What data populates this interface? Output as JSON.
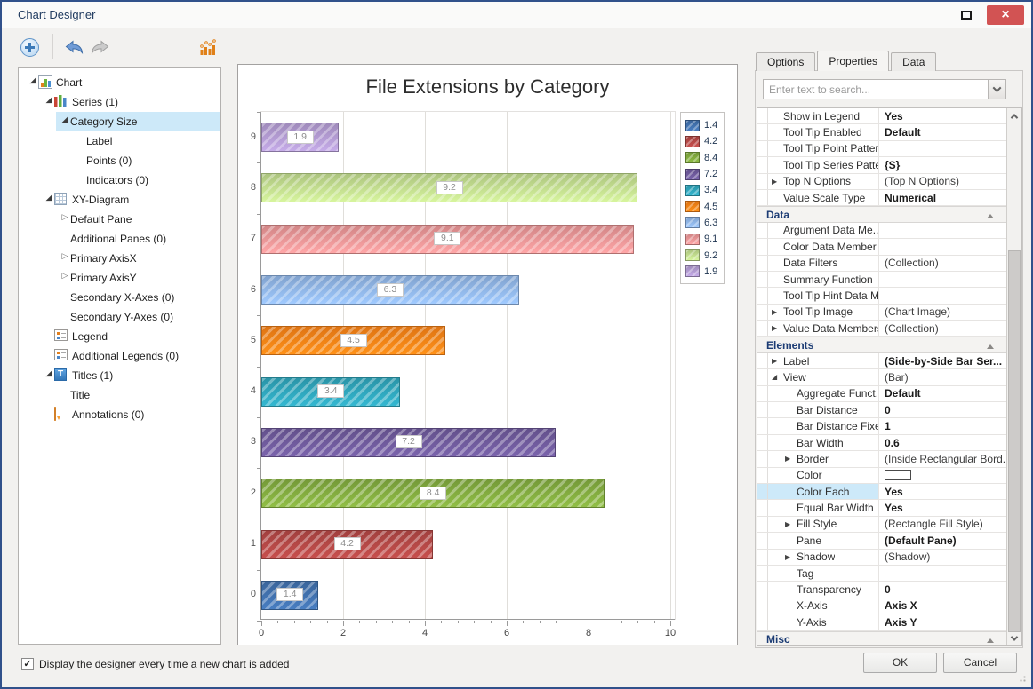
{
  "window": {
    "title": "Chart Designer"
  },
  "toolbar": {
    "buttons": [
      {
        "name": "add-chart-element-button",
        "icon": "plus-icon"
      },
      {
        "name": "undo-button",
        "icon": "undo-arrow-icon"
      },
      {
        "name": "redo-button",
        "icon": "redo-arrow-icon"
      },
      {
        "name": "chart-type-button",
        "icon": "bar-chart-icon"
      }
    ]
  },
  "icons": {
    "maximize": "square-outline",
    "close": "×",
    "checkbox_check": "✓"
  },
  "tree": {
    "items": [
      {
        "label": "Chart",
        "level": 0,
        "state": "expanded",
        "icon": "bar-chart"
      },
      {
        "label": "Series (1)",
        "level": 1,
        "state": "expanded",
        "icon": "series"
      },
      {
        "label": "Category Size",
        "level": 2,
        "state": "expanded",
        "selected": true
      },
      {
        "label": "Label",
        "level": 3
      },
      {
        "label": "Points (0)",
        "level": 3
      },
      {
        "label": "Indicators (0)",
        "level": 3
      },
      {
        "label": "XY-Diagram",
        "level": 1,
        "state": "expanded",
        "icon": "grid"
      },
      {
        "label": "Default Pane",
        "level": 2,
        "state": "collapsed"
      },
      {
        "label": "Additional Panes (0)",
        "level": 2
      },
      {
        "label": "Primary AxisX",
        "level": 2,
        "state": "collapsed"
      },
      {
        "label": "Primary AxisY",
        "level": 2,
        "state": "collapsed"
      },
      {
        "label": "Secondary X-Axes (0)",
        "level": 2
      },
      {
        "label": "Secondary Y-Axes (0)",
        "level": 2
      },
      {
        "label": "Legend",
        "level": 1,
        "icon": "legend"
      },
      {
        "label": "Additional Legends (0)",
        "level": 1,
        "icon": "legend"
      },
      {
        "label": "Titles (1)",
        "level": 1,
        "state": "expanded",
        "icon": "title"
      },
      {
        "label": "Title",
        "level": 2
      },
      {
        "label": "Annotations (0)",
        "level": 1,
        "icon": "annotation"
      }
    ]
  },
  "chart_data": {
    "type": "bar",
    "orientation": "horizontal",
    "title": "File Extensions by Category",
    "categories": [
      "0",
      "1",
      "2",
      "3",
      "4",
      "5",
      "6",
      "7",
      "8",
      "9"
    ],
    "values": [
      1.4,
      4.2,
      8.4,
      7.2,
      3.4,
      4.5,
      6.3,
      9.1,
      9.2,
      1.9
    ],
    "data_labels": [
      "1.4",
      "4.2",
      "8.4",
      "7.2",
      "3.4",
      "4.5",
      "6.3",
      "9.1",
      "9.2",
      "1.9"
    ],
    "bar_colors": [
      "#3e6da7",
      "#ad4543",
      "#7da53c",
      "#6a5695",
      "#2d9fb4",
      "#ef7d15",
      "#8aaede",
      "#e18f90",
      "#b9d387",
      "#ab94c9"
    ],
    "hatch": "diagonal-stripes",
    "xlabel": "",
    "ylabel": "",
    "xlim": [
      0,
      10.15
    ],
    "x_ticks": [
      0,
      2,
      4,
      6,
      8,
      10
    ],
    "grid": "vertical-major",
    "legend": {
      "position": "top-right",
      "labels": [
        "1.4",
        "4.2",
        "8.4",
        "7.2",
        "3.4",
        "4.5",
        "6.3",
        "9.1",
        "9.2",
        "1.9"
      ]
    }
  },
  "right_panel": {
    "tabs": [
      {
        "label": "Options",
        "active": false
      },
      {
        "label": "Properties",
        "active": true
      },
      {
        "label": "Data",
        "active": false
      }
    ],
    "search": {
      "placeholder": "Enter text to search..."
    },
    "property_grid": {
      "rows": [
        {
          "name": "Show in Legend",
          "value": "Yes",
          "bold": true
        },
        {
          "name": "Tool Tip Enabled",
          "value": "Default",
          "bold": true
        },
        {
          "name": "Tool Tip Point Pattern",
          "value": ""
        },
        {
          "name": "Tool Tip Series Pattern",
          "value": "{S}",
          "bold": true
        },
        {
          "name": "Top N Options",
          "value": "(Top N Options)",
          "arrow": "collapsed"
        },
        {
          "name": "Value Scale Type",
          "value": "Numerical",
          "bold": true
        },
        {
          "cat": "Data"
        },
        {
          "name": "Argument Data Me...",
          "value": ""
        },
        {
          "name": "Color Data Member",
          "value": ""
        },
        {
          "name": "Data Filters",
          "value": "(Collection)"
        },
        {
          "name": "Summary Function",
          "value": ""
        },
        {
          "name": "Tool Tip Hint Data M...",
          "value": ""
        },
        {
          "name": "Tool Tip Image",
          "value": "(Chart Image)",
          "arrow": "collapsed"
        },
        {
          "name": "Value Data Members",
          "value": "(Collection)",
          "arrow": "collapsed"
        },
        {
          "cat": "Elements"
        },
        {
          "name": "Label",
          "value": "(Side-by-Side Bar Ser...",
          "bold": true,
          "arrow": "collapsed"
        },
        {
          "name": "View",
          "value": "(Bar)",
          "arrow": "expanded"
        },
        {
          "name": "Aggregate Funct...",
          "value": "Default",
          "bold": true,
          "indent": 1
        },
        {
          "name": "Bar Distance",
          "value": "0",
          "bold": true,
          "indent": 1
        },
        {
          "name": "Bar Distance Fixed",
          "value": "1",
          "bold": true,
          "indent": 1
        },
        {
          "name": "Bar Width",
          "value": "0.6",
          "bold": true,
          "indent": 1
        },
        {
          "name": "Border",
          "value": "(Inside Rectangular Bord...",
          "arrow": "collapsed",
          "indent": 1
        },
        {
          "name": "Color",
          "value": "",
          "swatch": true,
          "indent": 1
        },
        {
          "name": "Color Each",
          "value": "Yes",
          "bold": true,
          "indent": 1,
          "selected": true
        },
        {
          "name": "Equal Bar Width",
          "value": "Yes",
          "bold": true,
          "indent": 1
        },
        {
          "name": "Fill Style",
          "value": "(Rectangle Fill Style)",
          "arrow": "collapsed",
          "indent": 1
        },
        {
          "name": "Pane",
          "value": "(Default Pane)",
          "bold": true,
          "indent": 1
        },
        {
          "name": "Shadow",
          "value": "(Shadow)",
          "arrow": "collapsed",
          "indent": 1
        },
        {
          "name": "Tag",
          "value": "",
          "indent": 1
        },
        {
          "name": "Transparency",
          "value": "0",
          "bold": true,
          "indent": 1
        },
        {
          "name": "X-Axis",
          "value": "Axis X",
          "bold": true,
          "indent": 1
        },
        {
          "name": "Y-Axis",
          "value": "Axis Y",
          "bold": true,
          "indent": 1
        },
        {
          "cat": "Misc"
        }
      ]
    }
  },
  "footer": {
    "checkbox_label": "Display the designer every time a new chart is added",
    "checkbox_checked": true,
    "ok_label": "OK",
    "cancel_label": "Cancel"
  },
  "colors": {
    "selection_highlight": "#cde9f9",
    "close_button": "#d25353",
    "category_text": "#1c3c74",
    "window_border": "#31518b"
  }
}
